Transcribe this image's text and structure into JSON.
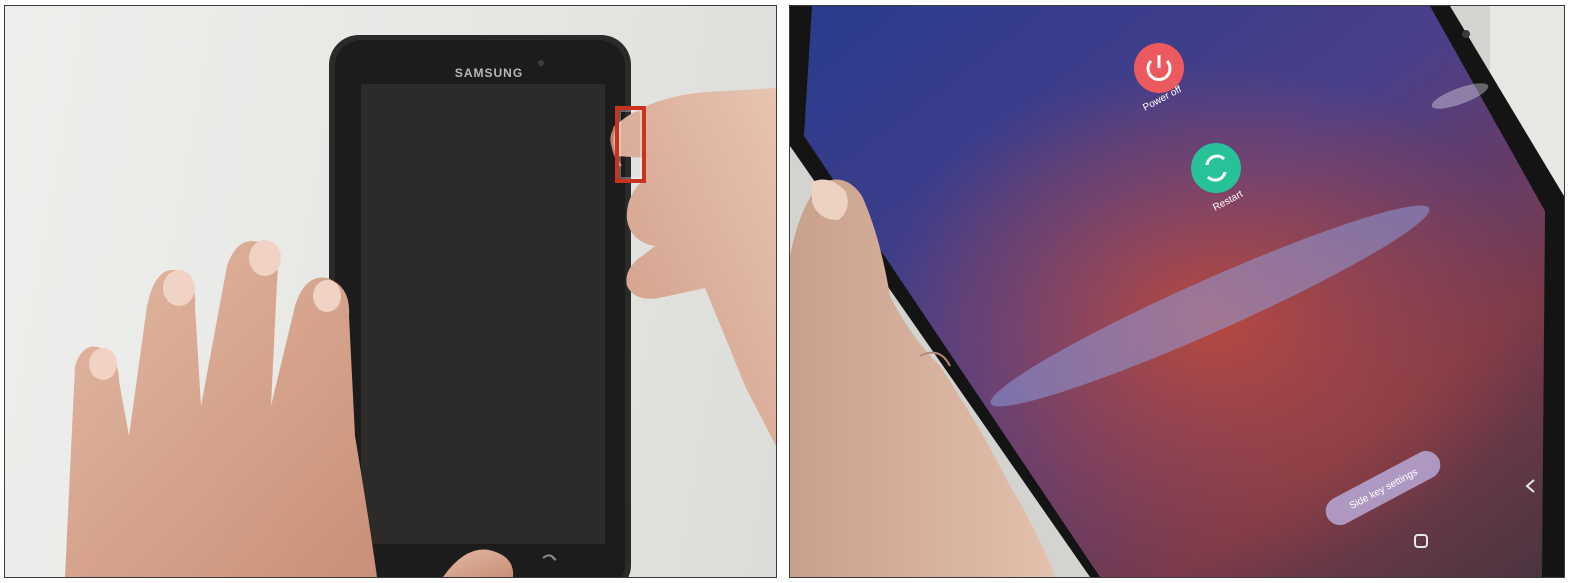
{
  "left_photo": {
    "brand": "SAMSUNG",
    "highlight_color": "#c8321e"
  },
  "right_photo": {
    "power_off_label": "Power off",
    "restart_label": "Restart",
    "side_key_label": "Side key settings",
    "power_off_color": "#ec5a5f",
    "restart_color": "#27c29a"
  }
}
